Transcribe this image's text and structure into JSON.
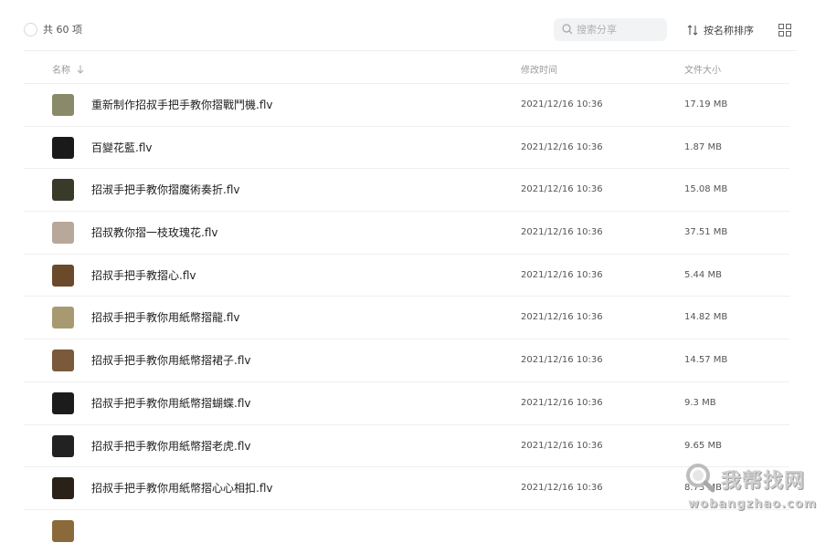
{
  "toolbar": {
    "count_label": "共 60 项",
    "search_placeholder": "搜索分享",
    "sort_label": "按名称排序"
  },
  "columns": {
    "name": "名称",
    "time": "修改时间",
    "size": "文件大小"
  },
  "files": [
    {
      "name": "重新制作招叔手把手教你摺戰鬥機.flv",
      "time": "2021/12/16 10:36",
      "size": "17.19 MB",
      "thumb": "#8a8a6a"
    },
    {
      "name": "百變花藍.flv",
      "time": "2021/12/16 10:36",
      "size": "1.87 MB",
      "thumb": "#1a1a1a"
    },
    {
      "name": "招淑手把手教你摺魔術奏折.flv",
      "time": "2021/12/16 10:36",
      "size": "15.08 MB",
      "thumb": "#3a3a2a"
    },
    {
      "name": "招叔教你摺一枝玫瑰花.flv",
      "time": "2021/12/16 10:36",
      "size": "37.51 MB",
      "thumb": "#b8a89a"
    },
    {
      "name": "招叔手把手教摺心.flv",
      "time": "2021/12/16 10:36",
      "size": "5.44 MB",
      "thumb": "#6a4a2a"
    },
    {
      "name": "招叔手把手教你用紙幣摺龍.flv",
      "time": "2021/12/16 10:36",
      "size": "14.82 MB",
      "thumb": "#a89a70"
    },
    {
      "name": "招叔手把手教你用紙幣摺裙子.flv",
      "time": "2021/12/16 10:36",
      "size": "14.57 MB",
      "thumb": "#7a5a3a"
    },
    {
      "name": "招叔手把手教你用紙幣摺蝴蝶.flv",
      "time": "2021/12/16 10:36",
      "size": "9.3 MB",
      "thumb": "#1c1c1c"
    },
    {
      "name": "招叔手把手教你用紙幣摺老虎.flv",
      "time": "2021/12/16 10:36",
      "size": "9.65 MB",
      "thumb": "#222222"
    },
    {
      "name": "招叔手把手教你用紙幣摺心心相扣.flv",
      "time": "2021/12/16 10:36",
      "size": "8.73 MB",
      "thumb": "#2a2218"
    }
  ],
  "watermark": {
    "text": "我帮找网",
    "url": "wobangzhao.com"
  }
}
